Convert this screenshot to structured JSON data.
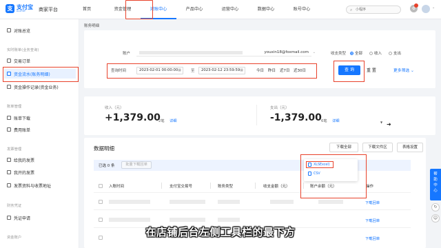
{
  "brand": {
    "logo_mark": "支",
    "name": "支付宝",
    "en": "ALIPAY",
    "platform": "商家平台"
  },
  "nav": [
    {
      "label": "首页"
    },
    {
      "label": "资金管理"
    },
    {
      "label": "对账中心"
    },
    {
      "label": "产品中心"
    },
    {
      "label": "运营中心"
    },
    {
      "label": "数据中心"
    },
    {
      "label": "账号中心"
    }
  ],
  "search": {
    "placeholder": "小程序"
  },
  "sidebar": {
    "item_overview": "对账总览",
    "group_realtime": "实时账单(业务查询)",
    "item_orders": "交易订单",
    "item_flow": "资金流水(账务明细)",
    "item_ops": "资金操作记录(资金业务)",
    "group_bill": "账单管理",
    "item_bill_dl": "账单下载",
    "item_fee": "费用账单",
    "group_invoice": "发票管理",
    "item_invoice_to_me": "给我的发票",
    "item_my_invoice": "我开的发票",
    "item_invoice_addr": "发票资料与收票地址",
    "group_voucher": "财务凭证",
    "item_voucher_apply": "凭证申请",
    "group_fund_acct": "资金账户"
  },
  "breadcrumb": "账务明细",
  "filter": {
    "account_label": "账户",
    "account_email": "youxin18@foxmail.com",
    "type_label": "收支类型",
    "type_options": [
      "全部",
      "收入",
      "支出"
    ],
    "query_time_label": "查询时间",
    "start": "2023-02-01 00:00:00",
    "to": "至",
    "end": "2023-02-12 23:59:59",
    "quick": [
      "今日",
      "昨日",
      "近7日",
      "近30日"
    ],
    "query_btn": "查 询",
    "reset_btn": "重 置",
    "more_filter": "更多筛选 ⌄"
  },
  "stats": {
    "income_label": "收入（元）",
    "income_value": "+1,379.00",
    "income_count": "2笔",
    "income_link": "详细",
    "expense_label": "支出（元）",
    "expense_value": "-1,379.00",
    "expense_count": "6笔",
    "expense_link": "详细"
  },
  "table": {
    "title": "数据明细",
    "btn_dl_all": "下载全部",
    "btn_dl_file": "下载文件区",
    "btn_table_settings": "表格设置",
    "selected": "已选 0 条",
    "batch_btn": "批量下载回单",
    "headers": [
      "入账时间",
      "支付宝交易号",
      "账务类型",
      "收支金额（元）",
      "账户余额（元）",
      "操作"
    ],
    "row_action": "下载回单"
  },
  "dropdown": {
    "xlsx": "XLSExcel)",
    "csv": "CSV"
  },
  "help": "帮\n助\n中\n心",
  "subtitle": "在店铺后台左侧工具栏的最下方"
}
